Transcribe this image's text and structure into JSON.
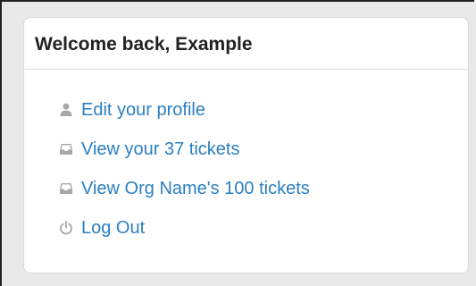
{
  "panel": {
    "title": "Welcome back, Example",
    "links": [
      {
        "label": "Edit your profile",
        "icon": "user-icon"
      },
      {
        "label": "View your 37 tickets",
        "icon": "inbox-icon"
      },
      {
        "label": "View Org Name's 100 tickets",
        "icon": "inbox-icon"
      },
      {
        "label": "Log Out",
        "icon": "power-icon"
      }
    ]
  },
  "colors": {
    "link": "#2a7fc2",
    "icon": "#a8a8a8",
    "title": "#222222"
  }
}
